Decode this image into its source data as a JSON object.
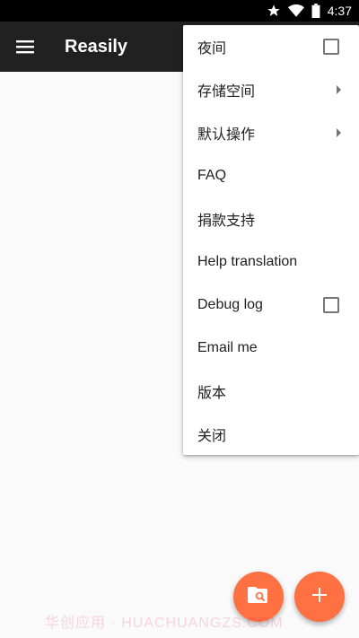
{
  "status_bar": {
    "time": "4:37",
    "icons": [
      "star-icon",
      "wifi-icon",
      "battery-icon"
    ]
  },
  "toolbar": {
    "title": "Reasily",
    "menu_icon": "hamburger-menu-icon"
  },
  "popup_menu": {
    "items": [
      {
        "label": "夜间",
        "control": "checkbox",
        "checked": false
      },
      {
        "label": "存储空间",
        "control": "submenu-arrow"
      },
      {
        "label": "默认操作",
        "control": "submenu-arrow"
      },
      {
        "label": "FAQ"
      },
      {
        "label": "捐款支持"
      },
      {
        "label": "Help translation"
      },
      {
        "label": "Debug log",
        "control": "checkbox",
        "checked": false
      },
      {
        "label": "Email me"
      },
      {
        "label": "版本"
      },
      {
        "label": "关闭"
      }
    ]
  },
  "fabs": {
    "search_folder_icon": "folder-search-icon",
    "add_icon": "plus-icon",
    "color": "#ff7043"
  },
  "watermark": "华创应用 · HUACHUANGZS.COM",
  "colors": {
    "toolbar": "#212121",
    "accent": "#ff7043"
  }
}
